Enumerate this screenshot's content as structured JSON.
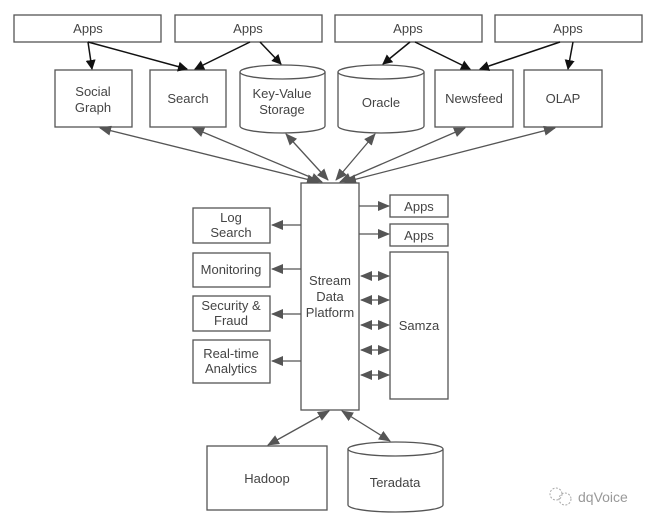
{
  "top_apps": [
    "Apps",
    "Apps",
    "Apps",
    "Apps"
  ],
  "services": {
    "social_graph": [
      "Social",
      "Graph"
    ],
    "search": "Search",
    "key_value": [
      "Key-Value",
      "Storage"
    ],
    "oracle": "Oracle",
    "newsfeed": "Newsfeed",
    "olap": "OLAP"
  },
  "platform": [
    "Stream",
    "Data",
    "Platform"
  ],
  "consumers": {
    "log_search": [
      "Log",
      "Search"
    ],
    "monitoring": "Monitoring",
    "security": [
      "Security &",
      "Fraud"
    ],
    "realtime": [
      "Real-time",
      "Analytics"
    ]
  },
  "right": {
    "apps1": "Apps",
    "apps2": "Apps",
    "samza": "Samza"
  },
  "bottom": {
    "hadoop": "Hadoop",
    "teradata": "Teradata"
  },
  "watermark": "dqVoice"
}
